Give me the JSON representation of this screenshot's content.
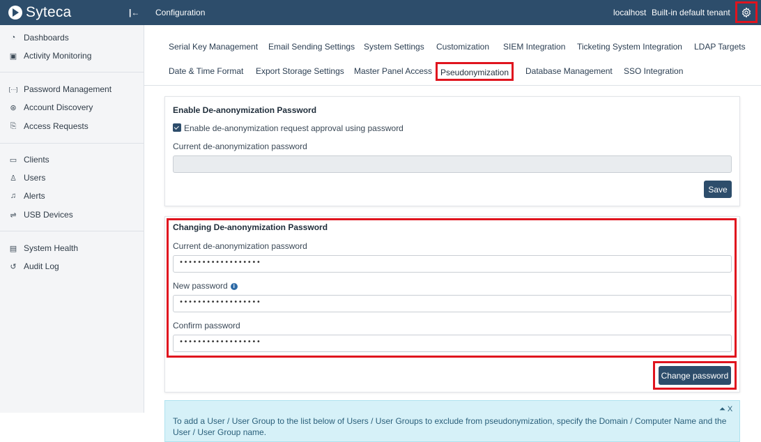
{
  "app": {
    "name": "Syteca"
  },
  "sidebar": {
    "items": [
      {
        "label": "Dashboards",
        "icon": "dashboard-icon",
        "glyph": "◔"
      },
      {
        "label": "Activity Monitoring",
        "icon": "monitor-play-icon",
        "glyph": "▣"
      },
      {
        "label": "Password Management",
        "icon": "password-icon",
        "glyph": "[···]"
      },
      {
        "label": "Account Discovery",
        "icon": "discovery-icon",
        "glyph": "⊛"
      },
      {
        "label": "Access Requests",
        "icon": "access-request-icon",
        "glyph": "⎘"
      },
      {
        "label": "Clients",
        "icon": "clients-icon",
        "glyph": "▭"
      },
      {
        "label": "Users",
        "icon": "user-icon",
        "glyph": "♙"
      },
      {
        "label": "Alerts",
        "icon": "bell-icon",
        "glyph": "♫"
      },
      {
        "label": "USB Devices",
        "icon": "usb-icon",
        "glyph": "⇌"
      },
      {
        "label": "System Health",
        "icon": "health-icon",
        "glyph": "▤"
      },
      {
        "label": "Audit Log",
        "icon": "history-icon",
        "glyph": "↺"
      }
    ]
  },
  "topbar": {
    "title": "Configuration",
    "host": "localhost",
    "tenant": "Built-in default tenant"
  },
  "tabs": {
    "row1": [
      "Serial Key Management",
      "Email Sending Settings",
      "System Settings",
      "Customization",
      "SIEM Integration",
      "Ticketing System Integration",
      "LDAP Targets"
    ],
    "row2": [
      "Date & Time Format",
      "Export Storage Settings",
      "Master Panel Access",
      "Pseudonymization",
      "Database Management",
      "SSO Integration"
    ],
    "active": "Pseudonymization"
  },
  "enable_card": {
    "title": "Enable De-anonymization Password",
    "checkbox_label": "Enable de-anonymization request approval using password",
    "checked": true,
    "current_label": "Current de-anonymization password",
    "current_value": "",
    "save_label": "Save"
  },
  "change_card": {
    "title": "Changing De-anonymization Password",
    "current_label": "Current de-anonymization password",
    "current_value": "••••••••••••••••••",
    "new_label": "New password",
    "new_value": "••••••••••••••••••",
    "confirm_label": "Confirm password",
    "confirm_value": "••••••••••••••••••",
    "button_label": "Change password"
  },
  "info_alert": {
    "text": "To add a User / User Group to the list below of Users / User Groups to exclude from pseudonymization, specify the Domain / Computer Name and the User / User Group name.",
    "controls": "⏶ X"
  },
  "colors": {
    "primary": "#2d4d6b",
    "highlight": "#e0141e",
    "info_bg": "#d6f1f8"
  }
}
